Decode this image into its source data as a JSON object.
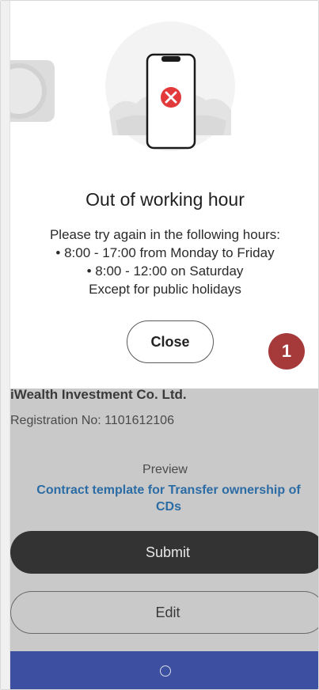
{
  "modal": {
    "title": "Out of working hour",
    "body_lines": [
      "Please try again in the following hours:",
      "• 8:00 - 17:00 from Monday to Friday",
      "• 8:00 - 12:00 on Saturday",
      "Except for public holidays"
    ],
    "close_label": "Close",
    "icons": {
      "illustration": "phone-error-illustration",
      "error": "x-circle-icon"
    },
    "colors": {
      "error_red": "#e23a3a"
    }
  },
  "step_badge": {
    "number": "1",
    "color": "#a63a3a"
  },
  "background": {
    "company_name": "iWealth Investment Co. Ltd.",
    "registration": "Registration No: 1101612106",
    "preview_label": "Preview",
    "contract_link": "Contract template for Transfer ownership of CDs",
    "submit_label": "Submit",
    "edit_label": "Edit",
    "colors": {
      "link": "#2c6ca5",
      "submit_bg": "#333333",
      "bottom_bar": "#3d4fa0"
    }
  }
}
